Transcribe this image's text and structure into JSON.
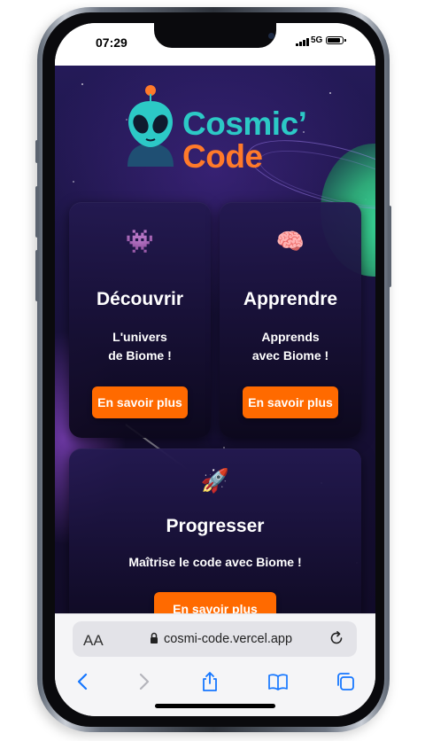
{
  "status": {
    "time": "07:29",
    "network": "5G",
    "battery_level": 0.9
  },
  "logo": {
    "line1": "Cosmic’",
    "line2": "Code",
    "colors": {
      "line1": "#2cc9c6",
      "line2": "#ff7a2a"
    },
    "mascot": "alien-mascot-icon"
  },
  "cards": [
    {
      "icon": "space-invader-icon",
      "emoji": "👾",
      "title": "Découvrir",
      "text_line1": "L'univers",
      "text_line2": "de Biome !",
      "button": "En savoir plus"
    },
    {
      "icon": "brain-icon",
      "emoji": "🧠",
      "title": "Apprendre",
      "text_line1": "Apprends",
      "text_line2": "avec Biome !",
      "button": "En savoir plus"
    },
    {
      "icon": "rocket-icon",
      "emoji": "🚀",
      "title": "Progresser",
      "text_line1": "Maîtrise le code avec Biome !",
      "button": "En savoir plus"
    }
  ],
  "browser": {
    "text_size_label": "AA",
    "url": "cosmi-code.vercel.app",
    "toolbar_icons": [
      "back-icon",
      "forward-icon",
      "share-icon",
      "bookmarks-icon",
      "tabs-icon"
    ]
  },
  "colors": {
    "accent": "#ff6a00",
    "background": "#1b1442",
    "teal": "#2cc9c6"
  }
}
